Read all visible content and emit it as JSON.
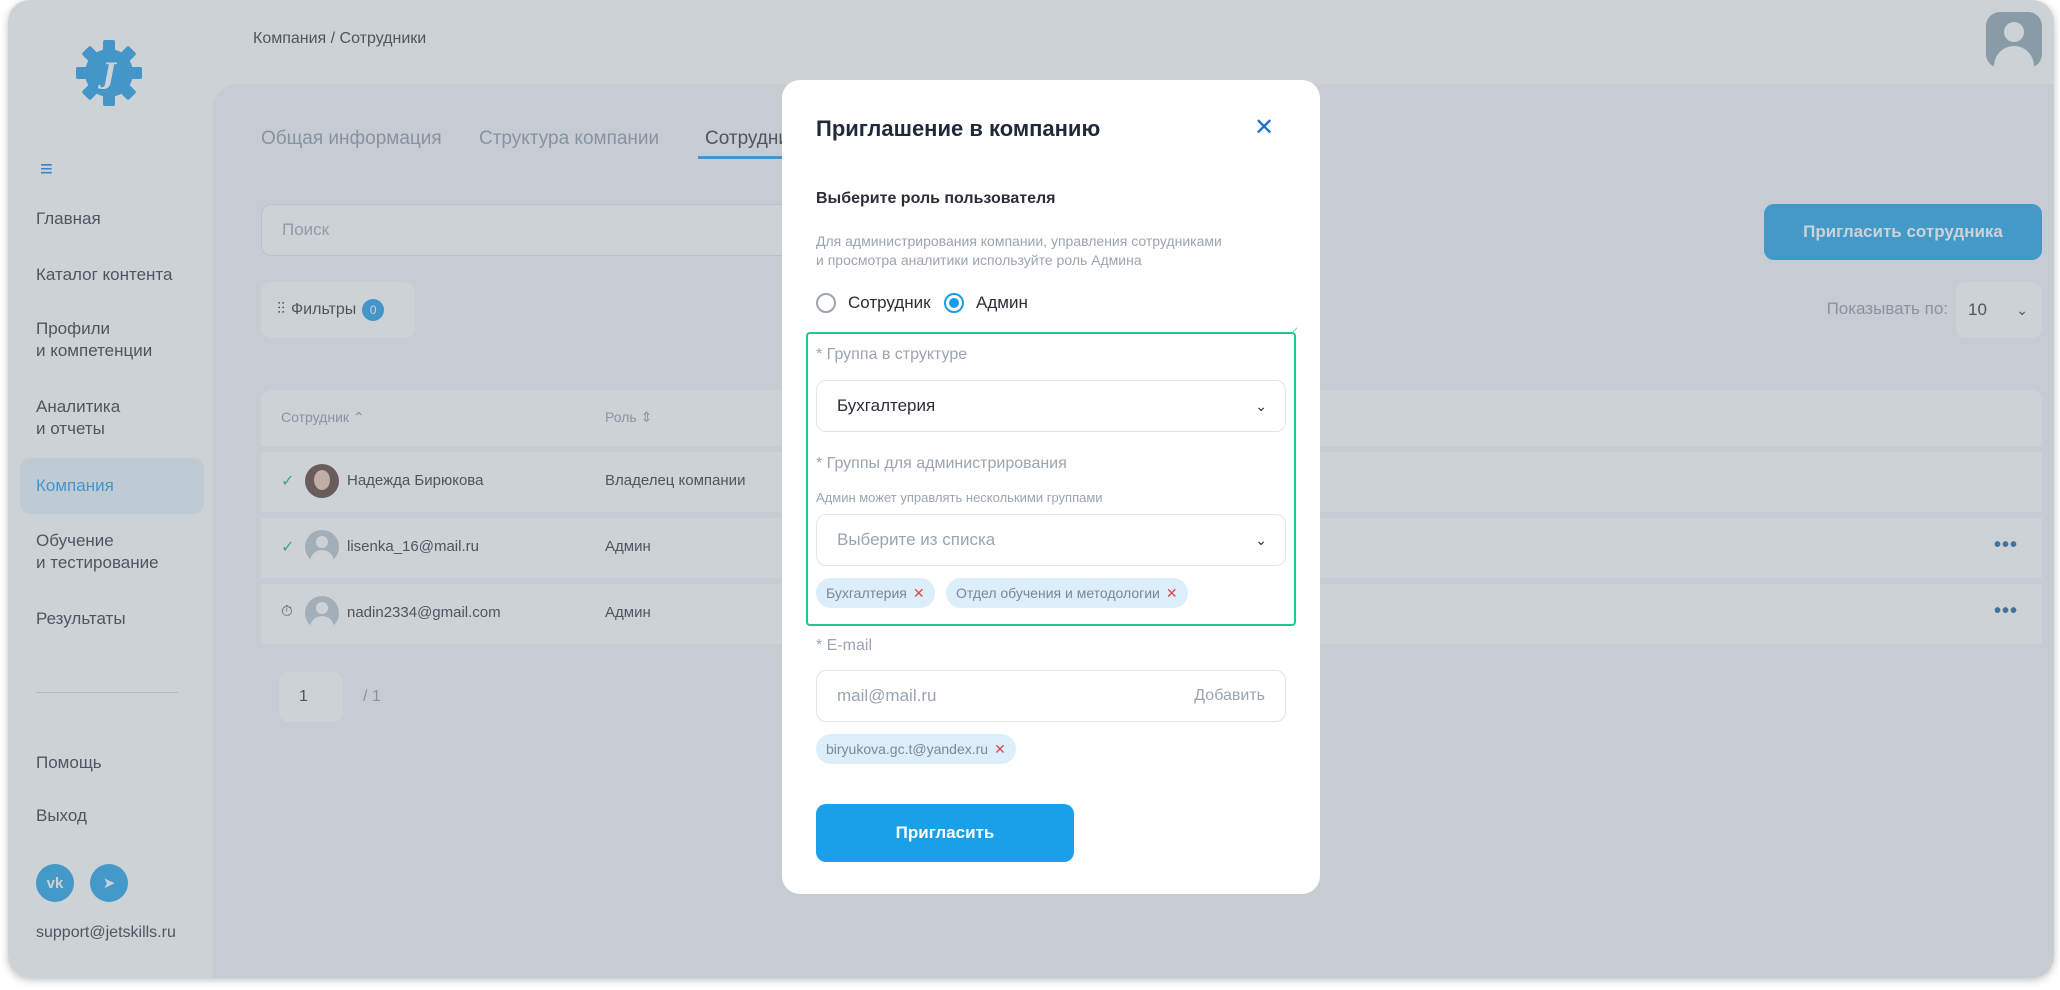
{
  "breadcrumb": "Компания / Сотрудники",
  "sidebar": {
    "items": [
      {
        "label": "Главная"
      },
      {
        "label": "Каталог контента"
      },
      {
        "label": "Профили",
        "label2": "и компетенции"
      },
      {
        "label": "Аналитика",
        "label2": "и отчеты"
      },
      {
        "label": "Компания"
      },
      {
        "label": "Обучение",
        "label2": "и тестирование"
      },
      {
        "label": "Результаты"
      }
    ],
    "help": "Помощь",
    "logout": "Выход",
    "support": "support@jetskills.ru",
    "social": [
      "vk-icon",
      "telegram-icon"
    ]
  },
  "tabs": [
    "Общая информация",
    "Структура компании",
    "Сотрудни"
  ],
  "search": {
    "placeholder": "Поиск"
  },
  "invite_button": "Пригласить сотрудника",
  "filters": {
    "label": "Фильтры",
    "count": "0"
  },
  "show": {
    "label": "Показывать по:",
    "value": "10"
  },
  "table": {
    "headers": [
      "Сотрудник",
      "Роль"
    ],
    "rows": [
      {
        "name": "Надежда Бирюкова",
        "role": "Владелец компании",
        "status": "✓"
      },
      {
        "name": "lisenka_16@mail.ru",
        "role": "Админ",
        "status": "✓"
      },
      {
        "name": "nadin2334@gmail.com",
        "role": "Админ",
        "status": "⏱"
      }
    ]
  },
  "pager": {
    "page": "1",
    "total": "/ 1"
  },
  "modal": {
    "title": "Приглашение в компанию",
    "role_title": "Выберите роль пользователя",
    "hint_line1": "Для администрирования компании, управления сотрудниками",
    "hint_line2": "и просмотра аналитики используйте роль Админа",
    "role_options": [
      "Сотрудник",
      "Админ"
    ],
    "selected_role": "Админ",
    "group_label": "* Группа в структуре",
    "group_value": "Бухгалтерия",
    "admin_groups_label": "* Группы для администрирования",
    "admin_groups_note": "Админ может управлять несколькими группами",
    "admin_groups_placeholder": "Выберите из списка",
    "admin_groups_chips": [
      "Бухгалтерия",
      "Отдел обучения и методологии"
    ],
    "email_label": "* E-mail",
    "email_placeholder": "mail@mail.ru",
    "email_add": "Добавить",
    "email_chips": [
      "biryukova.gc.t@yandex.ru"
    ],
    "submit": "Пригласить"
  },
  "colors": {
    "accent": "#1aa0e8",
    "highlight": "#1ec98c",
    "chip_remove": "#e04848"
  }
}
